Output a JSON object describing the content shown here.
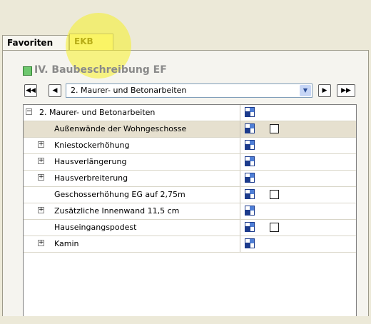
{
  "tabs": {
    "favoriten": "Favoriten",
    "ekb": "EKB"
  },
  "section": {
    "title": "IV. Baubeschreibung EF"
  },
  "navigator": {
    "selected": "2. Maurer- und Betonarbeiten"
  },
  "tree": {
    "rows": [
      {
        "label": "2. Maurer- und Betonarbeiten",
        "expander": "minus",
        "indent": 0,
        "checkbox": false,
        "selected": false
      },
      {
        "label": "Außenwände der Wohngeschosse",
        "expander": "none",
        "indent": 1,
        "checkbox": true,
        "selected": true
      },
      {
        "label": "Kniestockerhöhung",
        "expander": "plus",
        "indent": 1,
        "checkbox": false,
        "selected": false
      },
      {
        "label": "Hausverlängerung",
        "expander": "plus",
        "indent": 1,
        "checkbox": false,
        "selected": false
      },
      {
        "label": "Hausverbreiterung",
        "expander": "plus",
        "indent": 1,
        "checkbox": false,
        "selected": false
      },
      {
        "label": "Geschosserhöhung EG auf 2,75m",
        "expander": "none",
        "indent": 1,
        "checkbox": true,
        "selected": false
      },
      {
        "label": "Zusätzliche Innenwand 11,5 cm",
        "expander": "plus",
        "indent": 1,
        "checkbox": false,
        "selected": false
      },
      {
        "label": "Hauseingangspodest",
        "expander": "none",
        "indent": 1,
        "checkbox": true,
        "selected": false
      },
      {
        "label": "Kamin",
        "expander": "plus",
        "indent": 1,
        "checkbox": false,
        "selected": false
      }
    ]
  },
  "icons": {
    "first": "first-icon",
    "prev": "previous-icon",
    "next": "next-icon",
    "last": "last-icon",
    "dropdown": "chevron-down-icon",
    "document": "document-icon"
  }
}
